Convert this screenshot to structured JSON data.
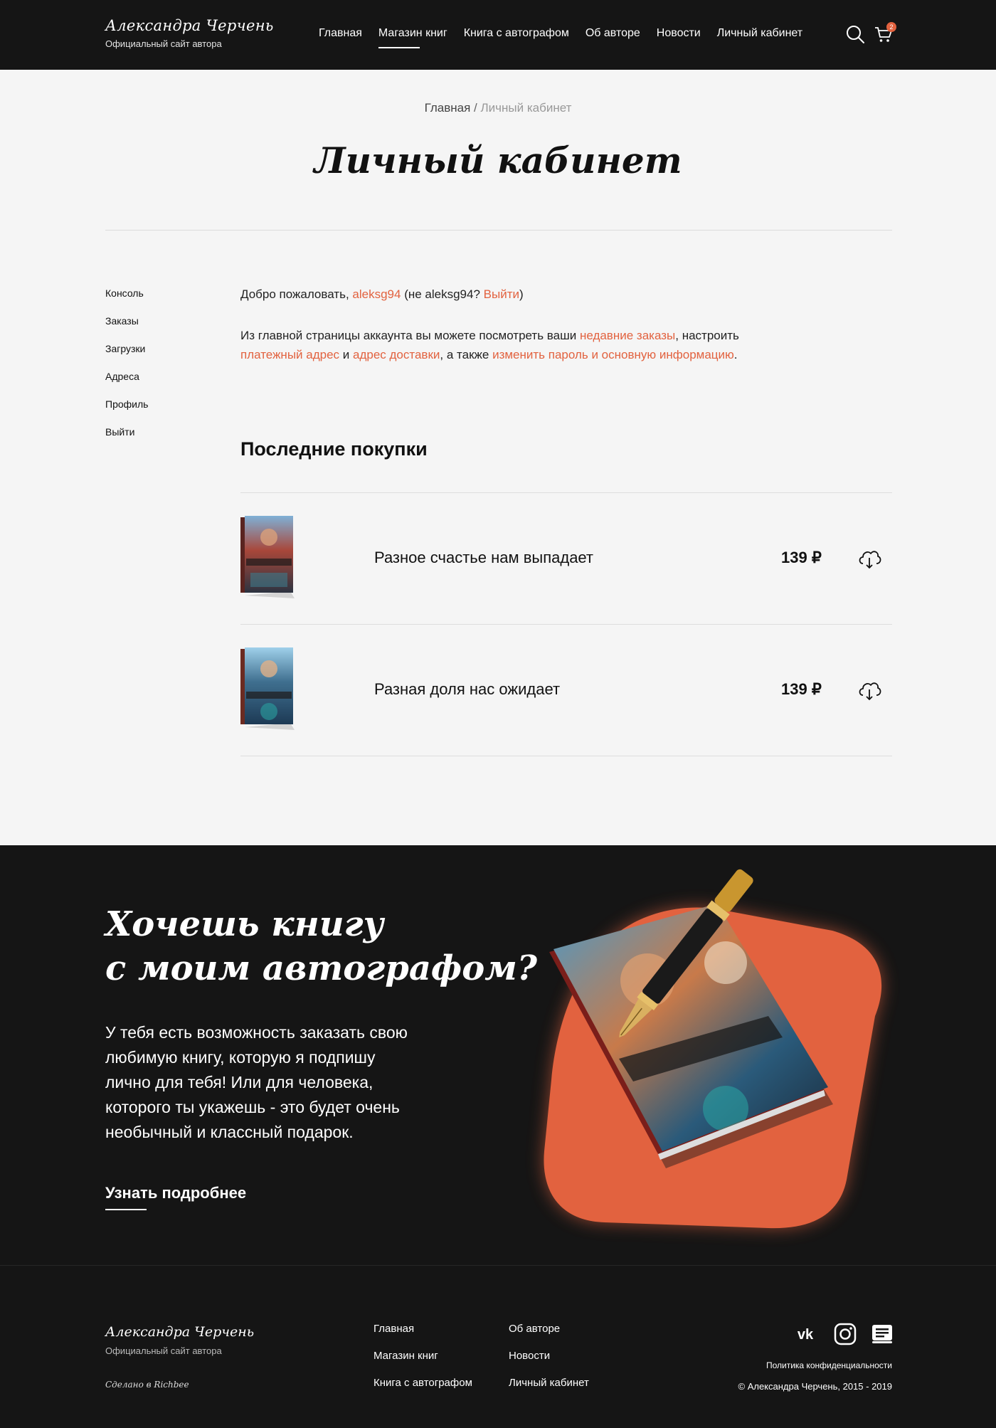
{
  "header": {
    "brand_name": "Александра Черчень",
    "brand_sub": "Официальный сайт автора",
    "nav": [
      {
        "label": "Главная"
      },
      {
        "label": "Магазин книг"
      },
      {
        "label": "Книга с автографом"
      },
      {
        "label": "Об авторе"
      },
      {
        "label": "Новости"
      },
      {
        "label": "Личный кабинет"
      }
    ],
    "active_nav": "Магазин книг",
    "cart_count": "2",
    "search_icon": "search-icon",
    "cart_icon": "cart-icon"
  },
  "breadcrumb": {
    "home": "Главная",
    "separator": "/",
    "current": "Личный кабинет"
  },
  "page_title": "Личный кабинет",
  "sidebar": {
    "items": [
      {
        "label": "Консоль"
      },
      {
        "label": "Заказы"
      },
      {
        "label": "Загрузки"
      },
      {
        "label": "Адреса"
      },
      {
        "label": "Профиль"
      },
      {
        "label": "Выйти"
      }
    ]
  },
  "welcome": {
    "prefix": "Добро пожаловать, ",
    "username": "aleksg94",
    "middle": " (не aleksg94? ",
    "logout": "Выйти",
    "suffix": ")"
  },
  "intro": {
    "p1": "Из главной страницы аккаунта вы можете посмотреть ваши ",
    "link_orders": "недавние заказы",
    "p2": ", настроить ",
    "link_billing": "платежный адрес",
    "p3": " и ",
    "link_shipping": "адрес доставки",
    "p4": ", а также ",
    "link_account": "изменить пароль и основную информацию",
    "p5": "."
  },
  "recent": {
    "title": "Последние покупки",
    "orders": [
      {
        "name": "Разное счастье нам выпадает",
        "price": "139 ₽",
        "icon": "cloud-download-icon"
      },
      {
        "name": "Разная доля нас ожидает",
        "price": "139 ₽",
        "icon": "cloud-download-icon"
      }
    ]
  },
  "promo": {
    "title_line1": "Хочешь книгу",
    "title_line2": "с моим автографом?",
    "text": "У тебя есть возможность заказать свою любимую книгу, которую я подпишу лично для тебя! Или для человека, которого ты укажешь - это будет очень необычный и классный подарок.",
    "link": "Узнать подробнее",
    "accent_color": "#e2623f"
  },
  "footer": {
    "brand_name": "Александра Черчень",
    "brand_sub": "Официальный сайт автора",
    "made_by": "Сделано в Richbee",
    "col1": [
      {
        "label": "Главная"
      },
      {
        "label": "Магазин книг"
      },
      {
        "label": "Книга с автографом"
      }
    ],
    "col2": [
      {
        "label": "Об авторе"
      },
      {
        "label": "Новости"
      },
      {
        "label": "Личный кабинет"
      }
    ],
    "social": [
      "vk-icon",
      "instagram-icon",
      "litres-book-icon"
    ],
    "policy": "Политика конфиденциальности",
    "copyright": "© Александра Черчень, 2015 - 2019"
  },
  "colors": {
    "accent": "#e2623f",
    "dark": "#151515",
    "page_bg": "#f5f5f5"
  }
}
